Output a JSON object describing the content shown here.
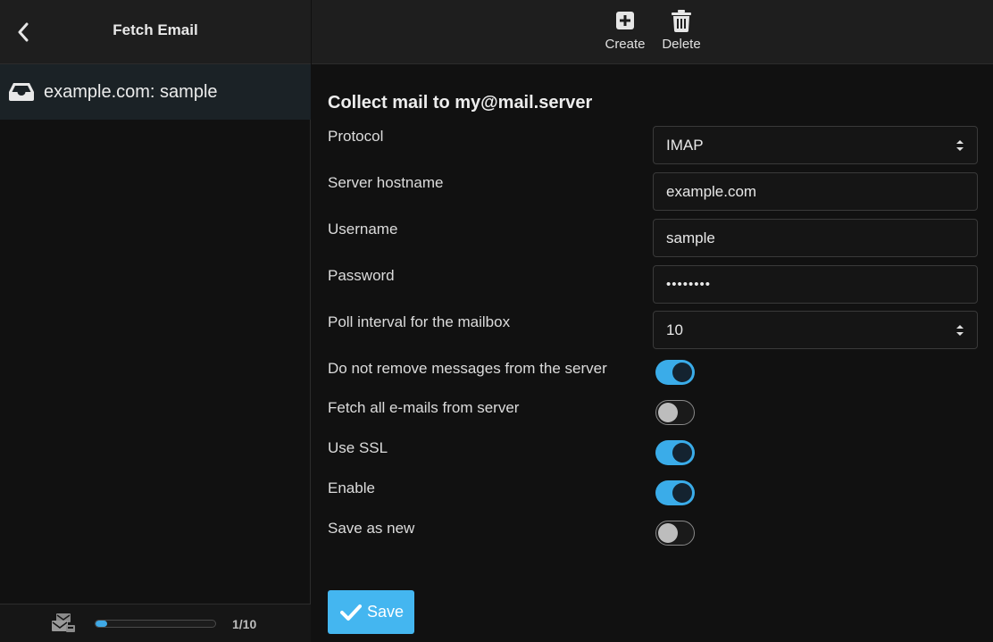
{
  "left_panel": {
    "title": "Fetch Email",
    "items": [
      {
        "label": "example.com: sample",
        "icon": "inbox-icon"
      }
    ],
    "footer": {
      "icon": "mail-queue-icon",
      "progress_fraction": 0.1,
      "page_counter": "1/10"
    }
  },
  "toolbar": {
    "create_label": "Create",
    "delete_label": "Delete"
  },
  "form": {
    "title": "Collect mail to my@mail.server",
    "protocol": {
      "label": "Protocol",
      "value": "IMAP"
    },
    "hostname": {
      "label": "Server hostname",
      "value": "example.com"
    },
    "username": {
      "label": "Username",
      "value": "sample"
    },
    "password": {
      "label": "Password",
      "value": "••••••••"
    },
    "poll_interval": {
      "label": "Poll interval for the mailbox",
      "value": "10"
    },
    "toggles": [
      {
        "label": "Do not remove messages from the server",
        "on": true
      },
      {
        "label": "Fetch all e-mails from server",
        "on": false
      },
      {
        "label": "Use SSL",
        "on": true
      },
      {
        "label": "Enable",
        "on": true
      },
      {
        "label": "Save as new",
        "on": false
      }
    ],
    "save_label": "Save"
  },
  "colors": {
    "accent": "#3aace9",
    "save_button": "#44b6f0",
    "background": "#111111",
    "header": "#1e1e1e"
  }
}
